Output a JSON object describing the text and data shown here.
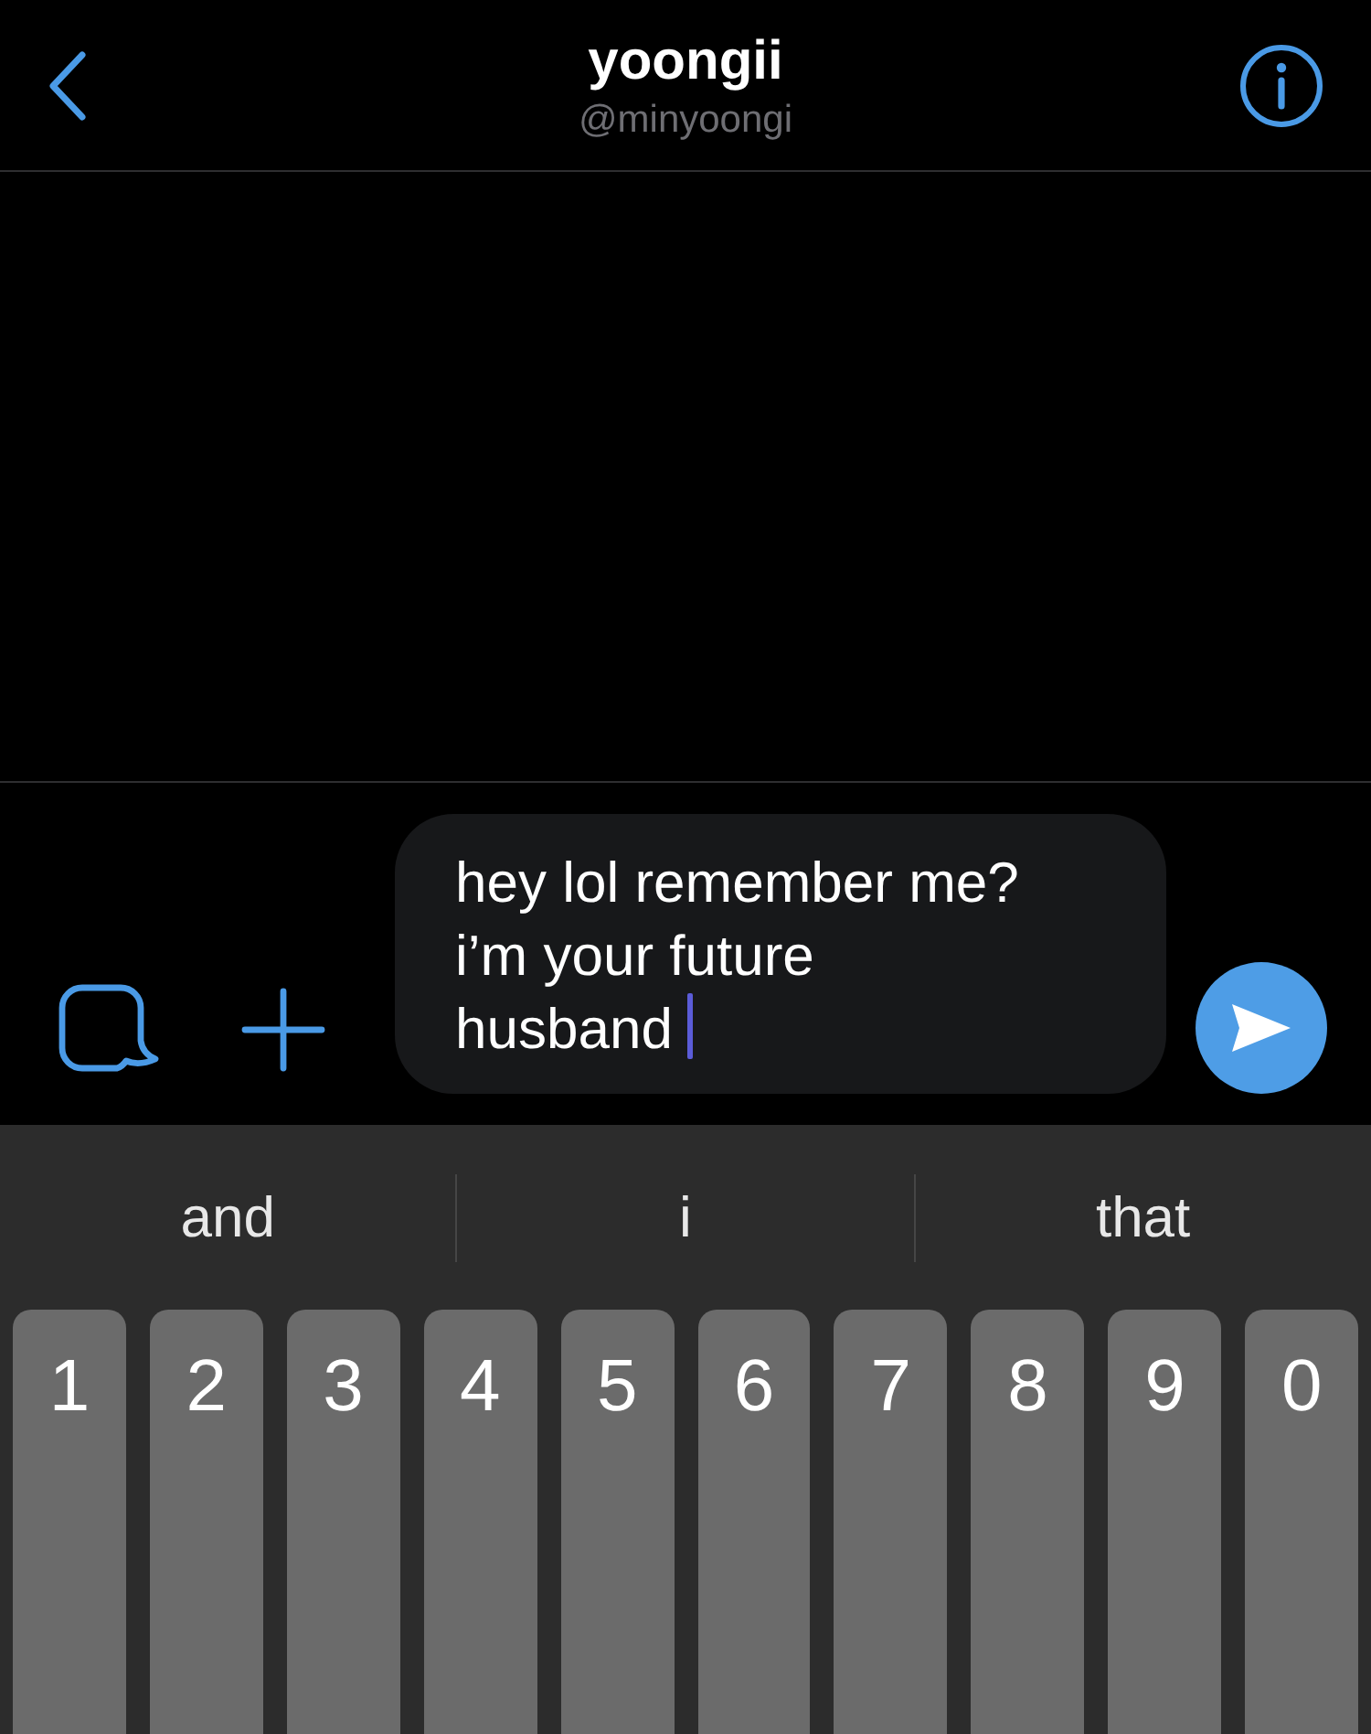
{
  "header": {
    "title": "yoongii",
    "handle": "@minyoongi"
  },
  "composer": {
    "value": "hey lol remember me? i’m your future husband",
    "focused": true
  },
  "keyboard": {
    "suggestions": [
      "and",
      "i",
      "that"
    ],
    "keys": [
      "1",
      "2",
      "3",
      "4",
      "5",
      "6",
      "7",
      "8",
      "9",
      "0"
    ]
  }
}
